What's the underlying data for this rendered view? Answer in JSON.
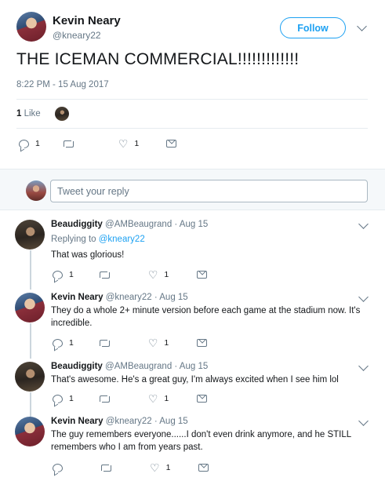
{
  "tweet": {
    "author_name": "Kevin Neary",
    "author_handle": "@kneary22",
    "follow_label": "Follow",
    "text": "THE ICEMAN COMMERCIAL!!!!!!!!!!!!!",
    "timestamp": "8:22 PM - 15 Aug 2017",
    "likes_count": "1",
    "likes_label": "Like",
    "actions": {
      "reply_count": "1",
      "retweet_count": "",
      "like_count": "1"
    }
  },
  "reply_box": {
    "placeholder": "Tweet your reply"
  },
  "replies": [
    {
      "name": "Beaudiggity",
      "handle": "@AMBeaugrand · Aug 15",
      "replying_prefix": "Replying to ",
      "replying_to": "@kneary22",
      "text": "That was glorious!",
      "reply_count": "1",
      "like_count": "1"
    },
    {
      "name": "Kevin Neary",
      "handle": "@kneary22 · Aug 15",
      "text": "They do a whole 2+ minute version before each game at the stadium now. It's incredible.",
      "reply_count": "1",
      "like_count": "1"
    },
    {
      "name": "Beaudiggity",
      "handle": "@AMBeaugrand · Aug 15",
      "text": "That's awesome. He's a great guy, I'm always excited when I see him lol",
      "reply_count": "1",
      "like_count": "1"
    },
    {
      "name": "Kevin Neary",
      "handle": "@kneary22 · Aug 15",
      "text": "The guy remembers everyone......I don't even drink anymore, and he STILL remembers who I am from years past.",
      "reply_count": "",
      "like_count": "1"
    }
  ],
  "colors": {
    "accent": "#1da1f2",
    "text": "#14171a",
    "muted": "#657786",
    "border": "#e6ecf0"
  },
  "icons": [
    "reply-icon",
    "retweet-icon",
    "heart-icon",
    "direct-message-icon",
    "chevron-down-icon"
  ]
}
